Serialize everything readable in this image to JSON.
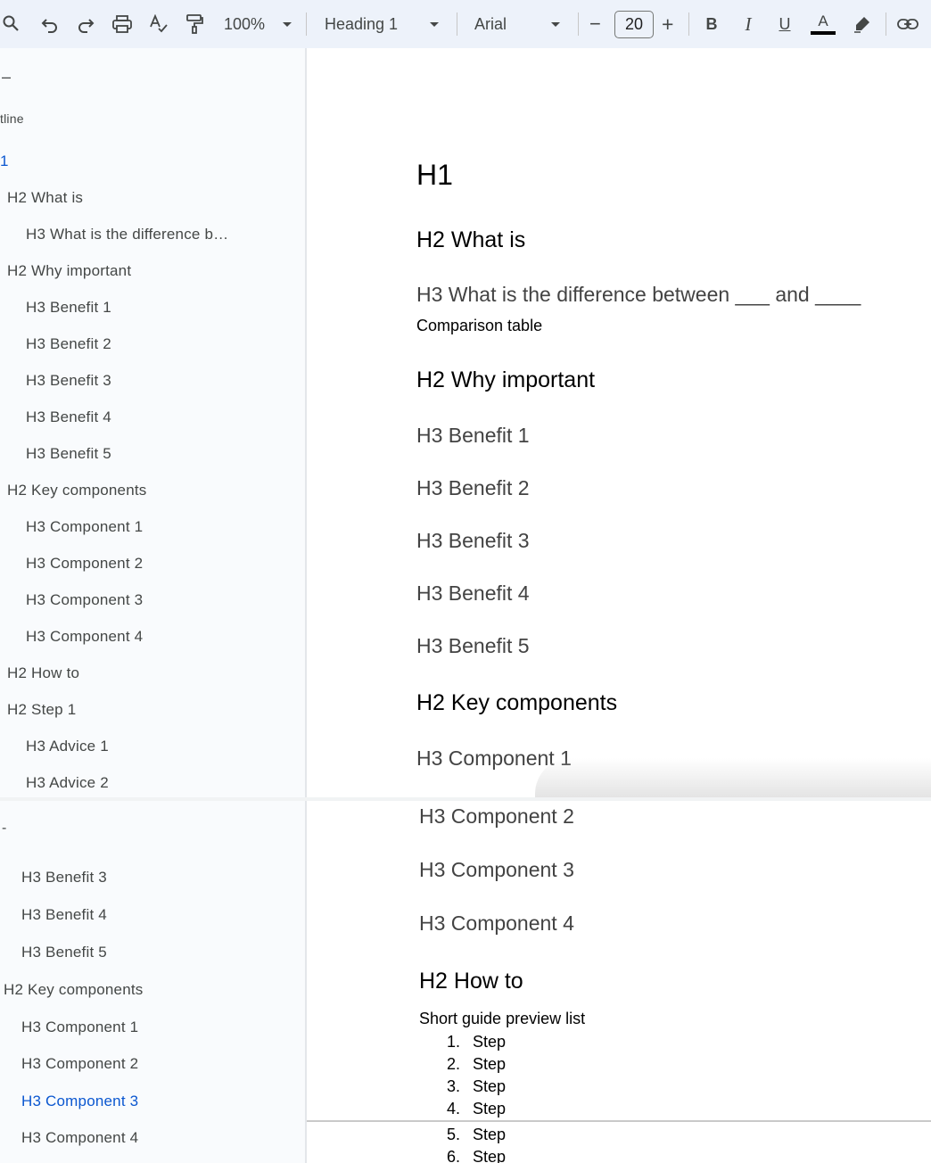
{
  "toolbar": {
    "zoom": "100%",
    "style": "Heading 1",
    "font": "Arial",
    "minus": "−",
    "font_size": "20",
    "plus": "+",
    "bold": "B",
    "italic": "I",
    "underline": "U",
    "text_color": "A",
    "icons": [
      "search-icon",
      "undo-icon",
      "redo-icon",
      "print-icon",
      "spellcheck-icon",
      "paint-format-icon",
      "highlight-icon",
      "link-icon"
    ]
  },
  "outline_top": {
    "collapse": "–",
    "header": "tline",
    "items": [
      {
        "label": "1",
        "level": 1
      },
      {
        "label": "H2 What is",
        "level": 2
      },
      {
        "label": "H3 What is the difference b…",
        "level": 3
      },
      {
        "label": "H2 Why important",
        "level": 2
      },
      {
        "label": "H3 Benefit 1",
        "level": 3
      },
      {
        "label": "H3 Benefit 2",
        "level": 3
      },
      {
        "label": "H3 Benefit 3",
        "level": 3
      },
      {
        "label": "H3 Benefit 4",
        "level": 3
      },
      {
        "label": "H3 Benefit 5",
        "level": 3
      },
      {
        "label": "H2 Key components",
        "level": 2
      },
      {
        "label": "H3 Component 1",
        "level": 3
      },
      {
        "label": "H3 Component 2",
        "level": 3
      },
      {
        "label": "H3 Component 3",
        "level": 3
      },
      {
        "label": "H3 Component 4",
        "level": 3
      },
      {
        "label": "H2 How to",
        "level": 2
      },
      {
        "label": "H2 Step 1",
        "level": 2
      },
      {
        "label": "H3 Advice 1",
        "level": 3
      },
      {
        "label": "H3 Advice 2",
        "level": 3
      }
    ]
  },
  "outline_bottom": {
    "collapse": "-",
    "items": [
      {
        "label": "H3 Benefit 3",
        "level": 3
      },
      {
        "label": "H3 Benefit 4",
        "level": 3
      },
      {
        "label": "H3 Benefit 5",
        "level": 3
      },
      {
        "label": "H2 Key components",
        "level": 2
      },
      {
        "label": "H3 Component 1",
        "level": 3
      },
      {
        "label": "H3 Component 2",
        "level": 3
      },
      {
        "label": "H3 Component 3",
        "level": 3,
        "active": true
      },
      {
        "label": "H3 Component 4",
        "level": 3
      }
    ]
  },
  "doc_top": {
    "h1": "H1",
    "h2_what": "H2 What is",
    "h3_diff": "H3 What is the difference between ___ and ____",
    "p_compare": "Comparison table",
    "h2_why": "H2 Why important",
    "benefits": [
      "H3 Benefit 1",
      "H3 Benefit 2",
      "H3 Benefit 3",
      "H3 Benefit 4",
      "H3 Benefit 5"
    ],
    "h2_key": "H2 Key components",
    "h3_comp1": "H3 Component 1"
  },
  "doc_bottom": {
    "components": [
      "H3 Component 2",
      "H3 Component 3",
      "H3 Component 4"
    ],
    "h2_how": "H2 How to",
    "p_guide": "Short guide preview list",
    "steps": [
      {
        "num": "1.",
        "text": "Step"
      },
      {
        "num": "2.",
        "text": "Step"
      },
      {
        "num": "3.",
        "text": "Step"
      },
      {
        "num": "4.",
        "text": "Step"
      },
      {
        "num": "5.",
        "text": "Step"
      },
      {
        "num": "6.",
        "text": "Step"
      }
    ]
  },
  "colors": {
    "toolbar_bg": "#edf2fa",
    "sidebar_bg": "#f9fbfd",
    "accent": "#0b57d0"
  }
}
